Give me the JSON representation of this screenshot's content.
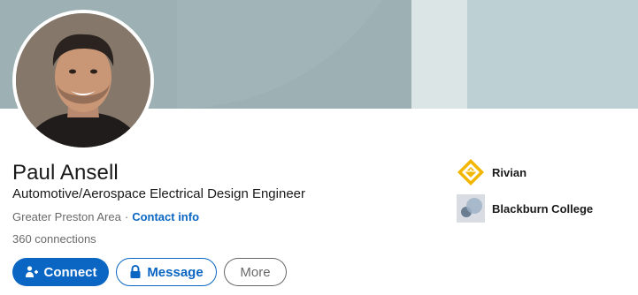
{
  "profile": {
    "name": "Paul Ansell",
    "headline": "Automotive/Aerospace Electrical Design Engineer",
    "location": "Greater Preston Area",
    "separator": "·",
    "contact_info": "Contact info",
    "connections": "360 connections"
  },
  "actions": {
    "connect": "Connect",
    "message": "Message",
    "more": "More"
  },
  "orgs": [
    {
      "name": "Rivian",
      "logo_icon": "rivian-logo"
    },
    {
      "name": "Blackburn College",
      "logo_icon": "blackburn-college-logo"
    }
  ],
  "colors": {
    "primary": "#0a66c2",
    "rivian": "#f2b705",
    "banner": "#9db1b4"
  }
}
